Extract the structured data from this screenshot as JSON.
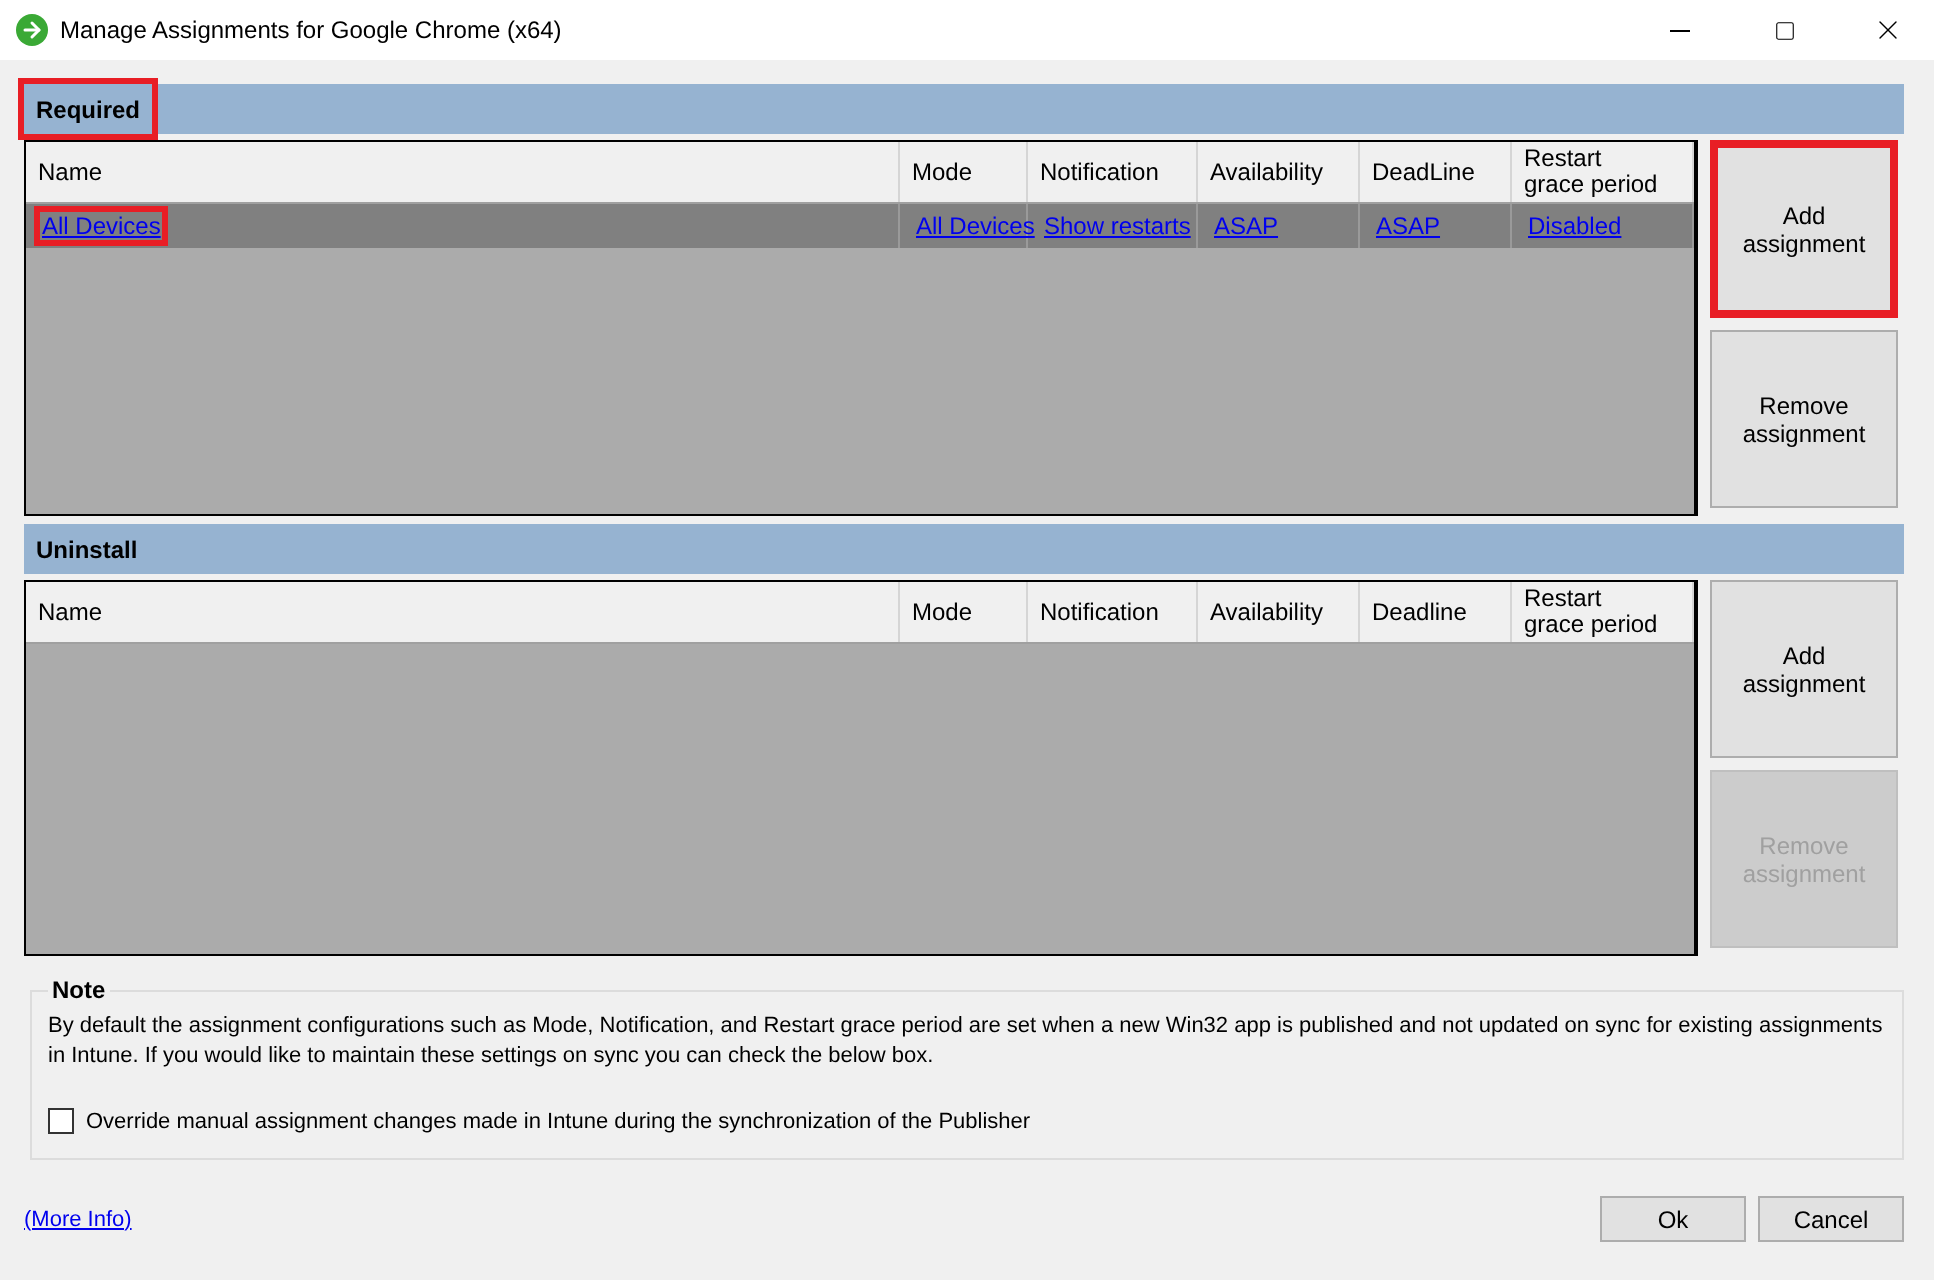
{
  "window": {
    "title": "Manage Assignments for Google Chrome (x64)"
  },
  "sections": [
    {
      "title": "Required",
      "highlighted": true,
      "columns": [
        "Name",
        "Mode",
        "Notification",
        "Availability",
        "DeadLine",
        "Restart\ngrace period"
      ],
      "rows": [
        {
          "selected": true,
          "cells": [
            {
              "text": "All Devices",
              "highlighted": true
            },
            {
              "text": "All Devices",
              "highlighted": false
            },
            {
              "text": "Show restarts",
              "highlighted": false
            },
            {
              "text": "ASAP",
              "highlighted": false
            },
            {
              "text": "ASAP",
              "highlighted": false
            },
            {
              "text": "Disabled",
              "highlighted": false
            }
          ]
        }
      ],
      "buttons": [
        {
          "label": "Add assignment",
          "disabled": false,
          "highlighted": true
        },
        {
          "label": "Remove assignment",
          "disabled": false,
          "highlighted": false
        }
      ]
    },
    {
      "title": "Uninstall",
      "highlighted": false,
      "columns": [
        "Name",
        "Mode",
        "Notification",
        "Availability",
        "Deadline",
        "Restart\ngrace period"
      ],
      "buttons": [
        {
          "label": "Add assignment",
          "disabled": false,
          "highlighted": false
        },
        {
          "label": "Remove assignment",
          "disabled": true,
          "highlighted": false
        }
      ]
    }
  ],
  "note": {
    "title": "Note",
    "text": "By default the assignment configurations such as Mode, Notification, and Restart grace period are set when a new Win32 app is published and not updated on sync for existing assignments in Intune. If you would like to maintain these settings on sync you can check the below box.",
    "checkbox": {
      "label": "Override manual assignment changes made in Intune during the synchronization of the Publisher",
      "checked": false
    }
  },
  "footer": {
    "link": "(More Info)",
    "buttons": [
      "Ok",
      "Cancel"
    ]
  }
}
